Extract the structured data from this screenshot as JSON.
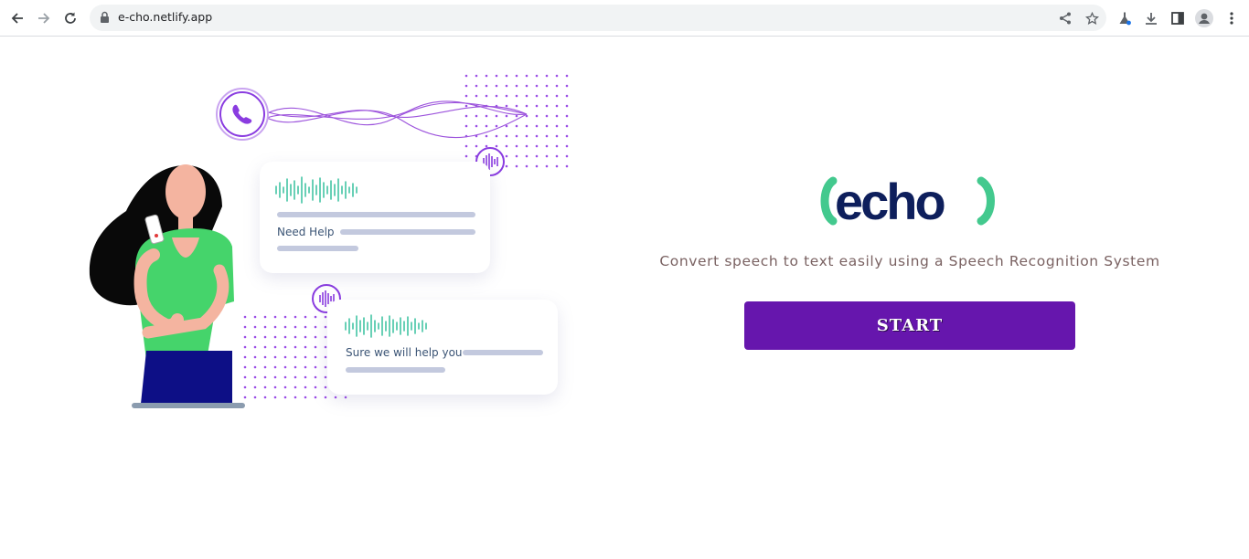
{
  "browser": {
    "url": "e-cho.netlify.app",
    "nav": {
      "back": "arrow-left-icon",
      "forward": "arrow-right-icon",
      "reload": "reload-icon"
    },
    "omnibox_actions": [
      "share-icon",
      "star-icon"
    ],
    "toolbar": [
      "labs-flask-icon",
      "download-icon",
      "side-panel-icon",
      "profile-avatar-icon",
      "more-vert-icon"
    ]
  },
  "illustration": {
    "bubble1_text": "Need Help",
    "bubble2_text": "Sure we will help you",
    "colors": {
      "purple": "#8a3ce0",
      "teal": "#43c4a4",
      "shirt": "#45d46b",
      "skirt": "#0d0f86",
      "skin": "#f4b4a0"
    }
  },
  "hero": {
    "logo_text": "echo",
    "tagline": "Convert speech to text easily using a Speech Recognition System",
    "start_label": "START",
    "colors": {
      "logo_navy": "#0e1f5c",
      "logo_green": "#43c98e",
      "button": "#6616ad",
      "tagline": "#7a6262"
    }
  }
}
